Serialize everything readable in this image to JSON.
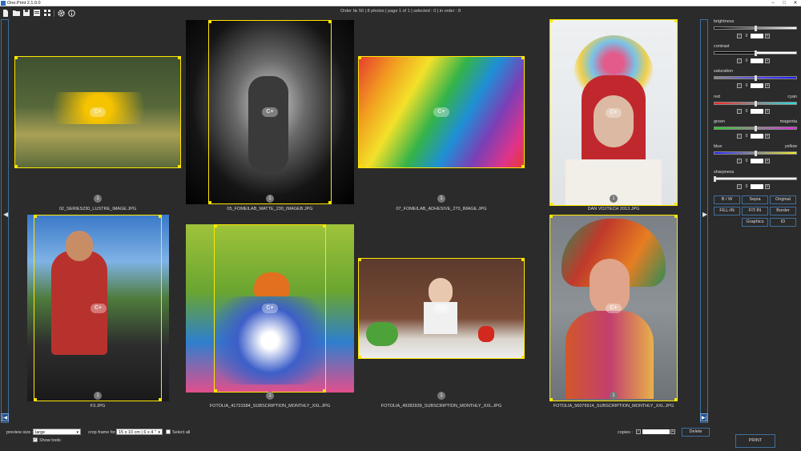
{
  "window": {
    "title": "One.Print 2.1.0.0",
    "minimize": "–",
    "maximize": "□",
    "close": "✕"
  },
  "toolbar": {
    "icons": [
      "new-file-icon",
      "open-folder-icon",
      "save-icon",
      "report-icon",
      "grid-icon",
      "gear-icon",
      "info-icon"
    ]
  },
  "order_info": "Order № 50  |  8 photos  |  page 1 of 1  |  selected : 0  |  in order : 8",
  "nav": {
    "left_arrow": "◀",
    "right_arrow": "▶",
    "first_page": "|◀",
    "last_page": "▶|"
  },
  "photos": [
    {
      "file": "02_SERIES230_LUSTRE_IMAGE.JPG",
      "copies": "1"
    },
    {
      "file": "05_FOMEILAB_MATTE_230_IMAGEB.JPG",
      "copies": "1"
    },
    {
      "file": "07_FOMEILAB_ADHESIVE_270_IMAGE.JPG",
      "copies": "1"
    },
    {
      "file": "DAN VOJTECH 2013.JPG",
      "copies": "1"
    },
    {
      "file": "F3.JPG",
      "copies": "1"
    },
    {
      "file": "FOTOLIA_41731584_SUBSCRIPTION_MONTHLY_XXL.JPG",
      "copies": "1"
    },
    {
      "file": "FOTOLIA_49282939_SUBSCRIPTION_MONTHLY_XXL.JPG",
      "copies": "1"
    },
    {
      "file": "FOTOLIA_56076914_SUBSCRIPTION_MONTHLY_XXL.JPG",
      "copies": "1"
    }
  ],
  "adjust": {
    "brightness": {
      "label": "brightness",
      "value": "0"
    },
    "contrast": {
      "label": "contrast",
      "value": "0"
    },
    "saturation": {
      "label": "saturation",
      "value": "0"
    },
    "red": {
      "label": "red",
      "right_label": "cyan",
      "value": "0"
    },
    "green": {
      "label": "green",
      "right_label": "magenta",
      "value": "0"
    },
    "blue": {
      "label": "blue",
      "right_label": "yellow",
      "value": "0"
    },
    "sharpness": {
      "label": "sharpness",
      "value": "0"
    },
    "minus": "-",
    "plus": "+"
  },
  "effects": {
    "bw": "B / W",
    "sepia": "Sepia",
    "original": "Original",
    "fill_in": "FILL-IN",
    "fit_in": "FIT-IN",
    "border": "Border",
    "graphics": "Graphics",
    "id": "ID"
  },
  "bottom": {
    "preview_size_label": "preview size :",
    "preview_size_value": "large",
    "show_tools": "Show tools",
    "crop_frame_label": "crop frame for :",
    "crop_frame_value": "15 x 10 cm | 6 x 4 \"",
    "select_all": "Select all",
    "copies_label": "copies :",
    "delete": "Delete",
    "print": "PRINT"
  },
  "watermark": "C+"
}
